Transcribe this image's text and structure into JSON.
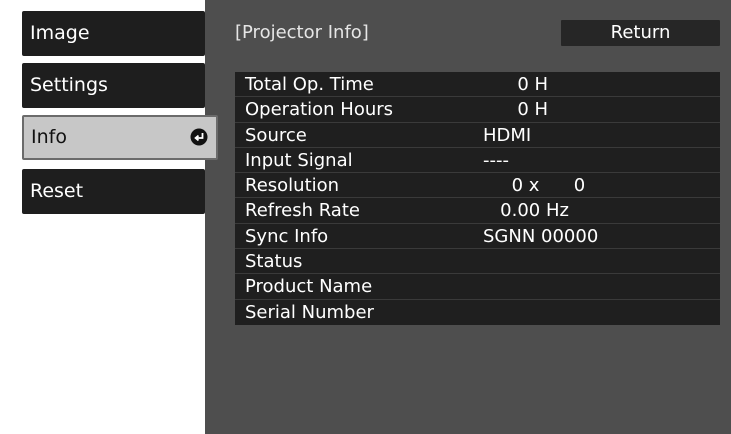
{
  "sidebar": {
    "items": [
      {
        "label": "Image"
      },
      {
        "label": "Settings"
      },
      {
        "label": "Info"
      },
      {
        "label": "Reset"
      }
    ],
    "selected_index": 2
  },
  "panel": {
    "title": "[Projector Info]",
    "return_label": "Return"
  },
  "info": {
    "rows": [
      {
        "label": "Total Op. Time",
        "value": "      0 H"
      },
      {
        "label": "Operation Hours",
        "value": "      0 H"
      },
      {
        "label": "Source",
        "value": "HDMI"
      },
      {
        "label": "Input Signal",
        "value": "----"
      },
      {
        "label": "Resolution",
        "value": "     0 x      0"
      },
      {
        "label": "Refresh Rate",
        "value": "   0.00 Hz"
      },
      {
        "label": "Sync Info",
        "value": "SGNN 00000"
      },
      {
        "label": "Status",
        "value": ""
      },
      {
        "label": "Product Name",
        "value": ""
      },
      {
        "label": "Serial Number",
        "value": ""
      }
    ]
  },
  "colors": {
    "panel_bg": "#4e4e4e",
    "menu_bg": "#1e1e1e",
    "menu_selected_bg": "#c7c7c7",
    "table_bg": "#1f1f1f"
  },
  "icons": {
    "enter": "enter-icon"
  }
}
